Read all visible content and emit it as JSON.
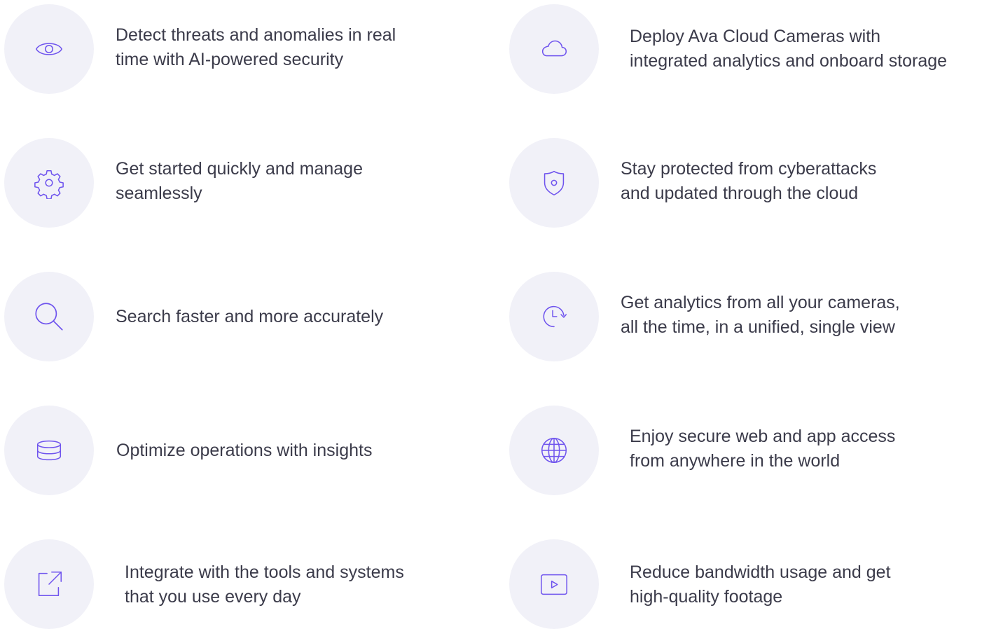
{
  "colors": {
    "icon_accent": "#6f54ee",
    "circle_bg": "#f1f1f8",
    "text": "#3b3b4a"
  },
  "features": [
    {
      "icon": "eye-icon",
      "text": "Detect threats and anomalies in real\ntime with AI-powered security"
    },
    {
      "icon": "cloud-icon",
      "text": "Deploy Ava Cloud Cameras with\nintegrated analytics and onboard storage"
    },
    {
      "icon": "gear-icon",
      "text": "Get started quickly and manage\nseamlessly"
    },
    {
      "icon": "shield-icon",
      "text": "Stay protected from cyberattacks\nand updated through the cloud"
    },
    {
      "icon": "search-icon",
      "text": "Search faster and more accurately"
    },
    {
      "icon": "clock-refresh-icon",
      "text": "Get analytics from all your cameras,\nall the time, in a unified, single view"
    },
    {
      "icon": "database-icon",
      "text": "Optimize operations with insights"
    },
    {
      "icon": "globe-icon",
      "text": "Enjoy secure web and app access\nfrom anywhere in the world"
    },
    {
      "icon": "external-link-icon",
      "text": "Integrate with the tools and systems\nthat you use every day"
    },
    {
      "icon": "play-video-icon",
      "text": "Reduce bandwidth usage and get\nhigh-quality footage"
    }
  ]
}
